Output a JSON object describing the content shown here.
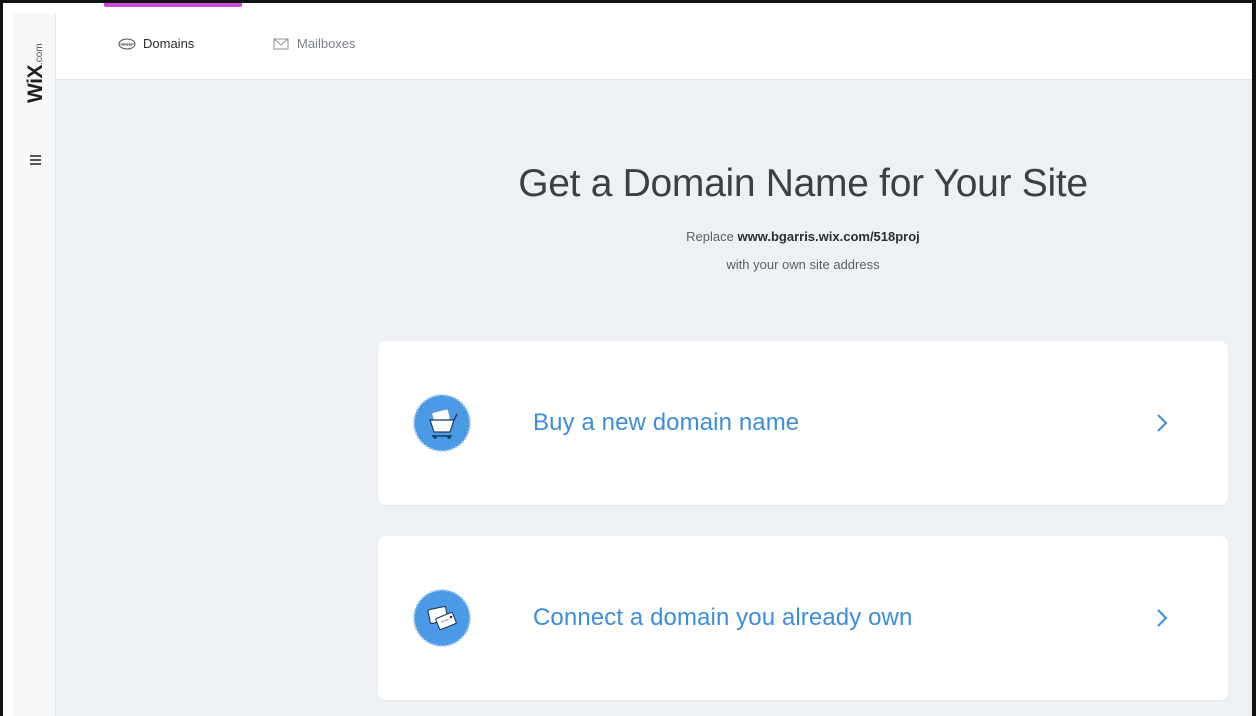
{
  "app": {
    "logo_text": "WiX",
    "logo_suffix": ".com"
  },
  "tabs": [
    {
      "label": "Domains",
      "icon": "domain-globe-icon",
      "active": true
    },
    {
      "label": "Mailboxes",
      "icon": "envelope-icon",
      "active": false
    }
  ],
  "colors": {
    "accent": "#c94bd6",
    "link": "#3d8ddd",
    "badge": "#4a9ae6",
    "background": "#eef1f4"
  },
  "hero": {
    "title": "Get a Domain Name for Your Site",
    "replace_prefix": "Replace",
    "site_url": "www.bgarris.wix.com/518proj",
    "subtitle": "with your own site address"
  },
  "options": [
    {
      "label": "Buy a new domain name",
      "icon": "shopping-cart-icon"
    },
    {
      "label": "Connect a domain you already own",
      "icon": "tags-icon"
    }
  ]
}
